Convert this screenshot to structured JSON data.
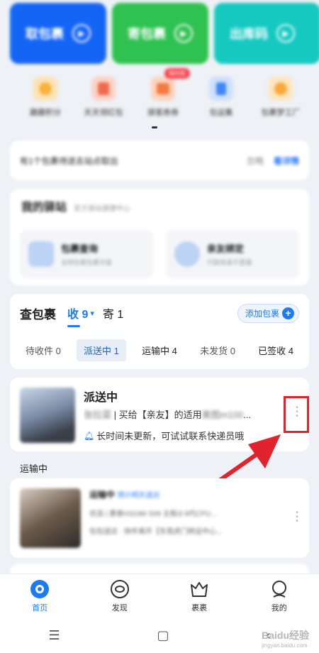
{
  "top_buttons": [
    {
      "label": "取包裹",
      "color": "#1565f5"
    },
    {
      "label": "寄包裹",
      "color": "#2fc251"
    },
    {
      "label": "出库码",
      "color": "#15c9c1"
    }
  ],
  "icon_row": {
    "items": [
      {
        "label": "趣趣积分",
        "icon": "coin-icon",
        "color": "#f7b33b"
      },
      {
        "label": "天天领红包",
        "icon": "redpacket-icon",
        "color": "#ef6a4a"
      },
      {
        "label": "驿客券券",
        "icon": "coupon-icon",
        "color": "#f47a3f"
      },
      {
        "label": "包运集",
        "icon": "bookmark-icon",
        "color": "#3d86f5"
      },
      {
        "label": "包裹梦工厂",
        "icon": "sun-icon",
        "color": "#f9a93a"
      }
    ],
    "badge": "限时抢"
  },
  "notice": {
    "text": "有1个包裹待送去站点取出",
    "ignore": "忽略",
    "detail": "看详情"
  },
  "station": {
    "title": "我的驿站",
    "subtitle": "官方驿站便捷中心",
    "cards": [
      {
        "title": "包裹查询",
        "desc": "全网包裹包裹可查"
      },
      {
        "title": "亲友绑定",
        "desc": "代取快递不遗漏"
      }
    ]
  },
  "query": {
    "title": "查包裹",
    "tab_receive": "收 9",
    "caret": "▾",
    "tab_send": "寄 1",
    "add_label": "添加包裹",
    "status_tabs": [
      "待收件 0",
      "派送中 1",
      "运输中 4",
      "未发货 0",
      "已签收 4"
    ]
  },
  "delivering": {
    "status": "派送中",
    "desc_blur_left": "张拉菜",
    "desc_visible": " | 买给【亲友】的适用",
    "desc_blur_right": "美图m100",
    "desc_tail": "...",
    "hint": "长时间未更新，可试试联系快递员哦"
  },
  "transit_section": {
    "label": "运输中",
    "title": "运输中",
    "eta": "预计明天送达",
    "line2": "优选 | 惠普H310M S09 主板i3 9代CPU...",
    "line3": "包包送达 · 快件离开【东莞虎门转运中心..."
  },
  "nav": [
    {
      "label": "首页",
      "icon": "home-icon",
      "active": true
    },
    {
      "label": "发现",
      "icon": "eye-icon",
      "active": false
    },
    {
      "label": "裹裹",
      "icon": "crown-icon",
      "active": false
    },
    {
      "label": "我的",
      "icon": "profile-icon",
      "active": false
    }
  ],
  "system_bar": {
    "menu": "☰",
    "home": "▢",
    "back": "‹"
  },
  "watermark": {
    "brand": "Baidu经验",
    "url": "jingyan.baidu.com"
  },
  "colors": {
    "accent": "#1e7af2",
    "highlight": "#e0232d"
  }
}
